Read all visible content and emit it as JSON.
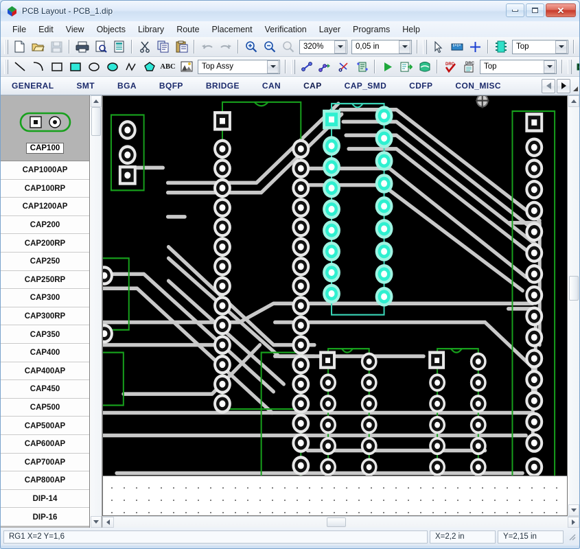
{
  "window": {
    "title": "PCB Layout - PCB_1.dip",
    "logo_icon": "pcb-layout-logo-icon",
    "minimize_label": "minimize-icon",
    "maximize_label": "maximize-icon",
    "close_label": "✕"
  },
  "menu": {
    "items": [
      {
        "label": "File"
      },
      {
        "label": "Edit"
      },
      {
        "label": "View"
      },
      {
        "label": "Objects"
      },
      {
        "label": "Library"
      },
      {
        "label": "Route"
      },
      {
        "label": "Placement"
      },
      {
        "label": "Verification"
      },
      {
        "label": "Layer"
      },
      {
        "label": "Programs"
      },
      {
        "label": "Help"
      }
    ]
  },
  "toolbar_main": {
    "buttons": [
      {
        "name": "new-file-icon",
        "title": "New"
      },
      {
        "name": "open-file-icon",
        "title": "Open"
      },
      {
        "name": "save-file-icon",
        "title": "Save",
        "disabled": true
      },
      {
        "name": "print-icon",
        "title": "Print"
      },
      {
        "name": "print-preview-icon",
        "title": "Print Preview"
      },
      {
        "name": "report-icon",
        "title": "Report"
      },
      {
        "name": "cut-icon",
        "title": "Cut"
      },
      {
        "name": "copy-icon",
        "title": "Copy"
      },
      {
        "name": "paste-icon",
        "title": "Paste"
      },
      {
        "name": "undo-icon",
        "title": "Undo",
        "disabled": true
      },
      {
        "name": "redo-icon",
        "title": "Redo",
        "disabled": true
      },
      {
        "name": "zoom-in-icon",
        "title": "Zoom In"
      },
      {
        "name": "zoom-out-icon",
        "title": "Zoom Out"
      },
      {
        "name": "zoom-fit-icon",
        "title": "Zoom Fit",
        "disabled": true
      }
    ],
    "zoom_value": "320%",
    "grid_value": "0,05 in",
    "tools": [
      {
        "name": "select-pointer-icon",
        "title": "Select"
      },
      {
        "name": "measure-icon",
        "title": "Measure"
      },
      {
        "name": "crosshair-icon",
        "title": "Origin"
      }
    ],
    "component_icon": "component-chip-icon",
    "layer_value": "Top",
    "right_buttons": [
      {
        "name": "pad-green-icon",
        "title": "Pad properties"
      },
      {
        "name": "via-pick-icon",
        "title": "Via pick"
      },
      {
        "name": "via-gray-icon",
        "title": "Via properties"
      }
    ]
  },
  "toolbar_draw": {
    "shapes": [
      {
        "name": "line-tool-icon",
        "title": "Line"
      },
      {
        "name": "arc-tool-icon",
        "title": "Arc"
      },
      {
        "name": "rectangle-tool-icon",
        "title": "Rectangle"
      },
      {
        "name": "filled-rectangle-tool-icon",
        "title": "Filled Rectangle"
      },
      {
        "name": "ellipse-tool-icon",
        "title": "Ellipse"
      },
      {
        "name": "filled-ellipse-tool-icon",
        "title": "Filled Ellipse"
      },
      {
        "name": "polyline-tool-icon",
        "title": "Polyline"
      },
      {
        "name": "polygon-tool-icon",
        "title": "Polygon"
      },
      {
        "name": "text-tool-icon",
        "title": "Text",
        "glyph": "ABC"
      },
      {
        "name": "image-tool-icon",
        "title": "Image"
      }
    ],
    "draw_layer_value": "Top Assy",
    "route_buttons": [
      {
        "name": "route-trace-icon",
        "title": "Route trace"
      },
      {
        "name": "route-manual-icon",
        "title": "Manual route"
      },
      {
        "name": "cut-trace-icon",
        "title": "Cut trace"
      },
      {
        "name": "trace-properties-icon",
        "title": "Trace properties"
      }
    ],
    "run_buttons": [
      {
        "name": "autoroute-run-icon",
        "title": "Autoroute"
      },
      {
        "name": "export-gerber-icon",
        "title": "Export"
      },
      {
        "name": "copper-pour-icon",
        "title": "Copper pour"
      }
    ],
    "check_buttons": [
      {
        "name": "drc-check-icon",
        "title": "DRC check",
        "glyph": "DRC"
      },
      {
        "name": "drc-report-icon",
        "title": "DRC report",
        "glyph": "DRC"
      }
    ],
    "route_layer_value": "Top",
    "extra_buttons": [
      {
        "name": "netlist-icon",
        "title": "Netlist"
      },
      {
        "name": "component-place-icon",
        "title": "Place component"
      },
      {
        "name": "component-settings-icon",
        "title": "Component settings"
      }
    ]
  },
  "category_tabs": {
    "items": [
      {
        "label": "GENERAL",
        "active": false
      },
      {
        "label": "SMT",
        "active": false
      },
      {
        "label": "BGA",
        "active": false
      },
      {
        "label": "BQFP",
        "active": false
      },
      {
        "label": "BRIDGE",
        "active": false
      },
      {
        "label": "CAN",
        "active": false
      },
      {
        "label": "CAP",
        "active": true
      },
      {
        "label": "CAP_SMD",
        "active": false
      },
      {
        "label": "CDFP",
        "active": false
      },
      {
        "label": "CON_MISC",
        "active": false
      }
    ],
    "prev_label": "scroll-tabs-left",
    "next_label": "scroll-tabs-right"
  },
  "component_list": {
    "preview": {
      "label": "CAP100",
      "icon": "capacitor-footprint-preview"
    },
    "items": [
      {
        "label": "CAP1000AP"
      },
      {
        "label": "CAP100RP"
      },
      {
        "label": "CAP1200AP"
      },
      {
        "label": "CAP200"
      },
      {
        "label": "CAP200RP"
      },
      {
        "label": "CAP250"
      },
      {
        "label": "CAP250RP"
      },
      {
        "label": "CAP300"
      },
      {
        "label": "CAP300RP"
      },
      {
        "label": "CAP350"
      },
      {
        "label": "CAP400"
      },
      {
        "label": "CAP400AP"
      },
      {
        "label": "CAP450"
      },
      {
        "label": "CAP500"
      },
      {
        "label": "CAP500AP"
      },
      {
        "label": "CAP600AP"
      },
      {
        "label": "CAP700AP"
      },
      {
        "label": "CAP800AP"
      },
      {
        "label": "DIP-14"
      },
      {
        "label": "DIP-16"
      }
    ]
  },
  "canvas": {
    "background_color": "#000000",
    "trace_color": "#c8c8c8",
    "pad_color": "#ffffff",
    "outline_color": "#17a01c",
    "selected_color": "#2ff0d0",
    "selected_outline_color": "#3ad6b8",
    "grid_area_color": "#ffffff",
    "grid_dot_color": "#555555"
  },
  "statusbar": {
    "message": "RG1  X=2  Y=1,6",
    "coord_x": "X=2,2 in",
    "coord_y": "Y=2,15 in"
  }
}
